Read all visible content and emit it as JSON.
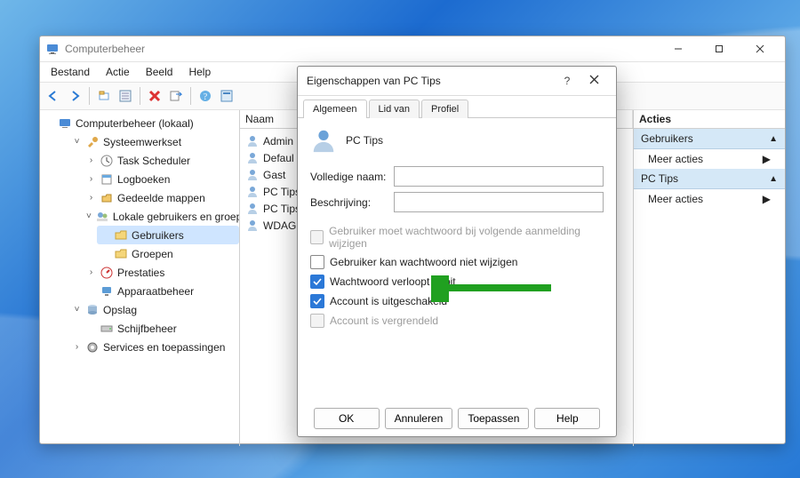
{
  "window": {
    "title": "Computerbeheer",
    "menus": [
      "Bestand",
      "Actie",
      "Beeld",
      "Help"
    ]
  },
  "tree": {
    "root": {
      "label": "Computerbeheer (lokaal)",
      "expanded": true
    },
    "system": {
      "label": "Systeemwerkset",
      "expanded": true
    },
    "task": {
      "label": "Task Scheduler"
    },
    "event": {
      "label": "Logboeken"
    },
    "shared": {
      "label": "Gedeelde mappen"
    },
    "localusers": {
      "label": "Lokale gebruikers en groepen",
      "expanded": true
    },
    "users": {
      "label": "Gebruikers",
      "selected": true
    },
    "groups": {
      "label": "Groepen"
    },
    "perf": {
      "label": "Prestaties"
    },
    "devmgr": {
      "label": "Apparaatbeheer"
    },
    "storage": {
      "label": "Opslag",
      "expanded": true
    },
    "disk": {
      "label": "Schijfbeheer"
    },
    "services": {
      "label": "Services en toepassingen"
    }
  },
  "list": {
    "header": "Naam",
    "rows": [
      "Admin",
      "Defaul",
      "Gast",
      "PC Tips",
      "PC Tips",
      "WDAG"
    ]
  },
  "actions": {
    "header": "Acties",
    "section1": "Gebruikers",
    "section2": "PC Tips",
    "more": "Meer acties"
  },
  "dialog": {
    "title": "Eigenschappen van PC Tips",
    "tabs": [
      "Algemeen",
      "Lid van",
      "Profiel"
    ],
    "name": "PC Tips",
    "field_fullname": "Volledige naam:",
    "field_desc": "Beschrijving:",
    "chk_mustchange": "Gebruiker moet wachtwoord bij volgende aanmelding wijzigen",
    "chk_cannotchange": "Gebruiker kan wachtwoord niet wijzigen",
    "chk_neverexpire": "Wachtwoord verloopt nooit",
    "chk_disabled": "Account is uitgeschakeld",
    "chk_locked": "Account is vergrendeld",
    "btn_ok": "OK",
    "btn_cancel": "Annuleren",
    "btn_apply": "Toepassen",
    "btn_help": "Help"
  }
}
